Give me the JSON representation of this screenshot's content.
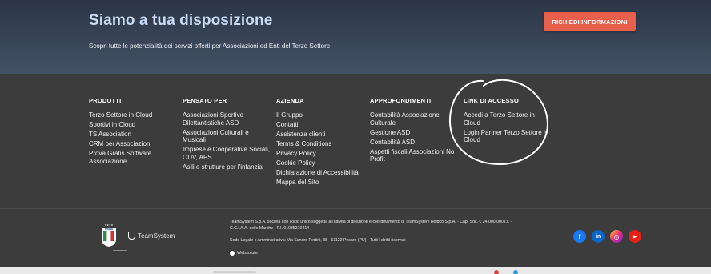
{
  "hero": {
    "title": "Siamo a tua disposizione",
    "subtitle": "Scopri tutte le potenzialità dei servizi offerti per Associazioni ed Enti del Terzo Settore",
    "cta_label": "RICHIEDI INFORMAZIONI"
  },
  "footer": {
    "columns": [
      {
        "heading": "PRODOTTI",
        "items": [
          "Terzo Settore in Cloud",
          "Sportivi in Cloud",
          "TS Association",
          "CRM per Associazioni",
          "Prova Gratis Software Associazione"
        ]
      },
      {
        "heading": "PENSATO PER",
        "items": [
          "Associazioni Sportive Dilettantistiche ASD",
          "Associazioni Culturali e Musicali",
          "Imprese e Cooperative Sociali, ODV, APS",
          "Asili e strutture per l'infanzia"
        ]
      },
      {
        "heading": "AZIENDA",
        "items": [
          "Il Gruppo",
          "Contatti",
          "Assistenza clienti",
          "Terms & Conditions",
          "Privacy Policy",
          "Cookie Policy",
          "Dichiarazione di Accessibilità",
          "Mappa del Sito"
        ]
      },
      {
        "heading": "APPROFONDIMENTI",
        "items": [
          "Contabilità Associazione Culturale",
          "Gestione ASD",
          "Contabilità ASD",
          "Aspetti fiscali Associazioni No Profit"
        ]
      },
      {
        "heading": "LINK DI ACCESSO",
        "items": [
          "Accedi a Terzo Settore in Cloud",
          "Login Partner Terzo Settore in Cloud"
        ]
      }
    ]
  },
  "bottom": {
    "brand": "TeamSystem",
    "legal_line1": "TeamSystem S.p.A. società con socio unico soggetta all'attività di direzione e coordinamento di TeamSystem Holdco S.p.A. - Cap. Soc. € 24.000.000 i.v. - C.C.I.A.A. delle Marche - P.I. 01035310414",
    "legal_line2": "Sede Legale e Amministrativa: Via Sandro Pertini, 88 - 61122 Pesaro (PU) - Tutti i diritti riservati",
    "websolute": "Websolute",
    "logo_text": "ITALIA"
  },
  "socials": [
    {
      "icon": "facebook-icon",
      "glyph": "f",
      "color": "#1877f2"
    },
    {
      "icon": "linkedin-icon",
      "glyph": "in",
      "color": "#0a66c2"
    },
    {
      "icon": "instagram-icon",
      "glyph": "◎",
      "color": "#d62976"
    },
    {
      "icon": "youtube-icon",
      "glyph": "▶",
      "color": "#e62117"
    }
  ],
  "colors": {
    "cta": "#e8604c",
    "hero_title": "#c9dcf7",
    "footer_bg": "#3c3c3c"
  }
}
